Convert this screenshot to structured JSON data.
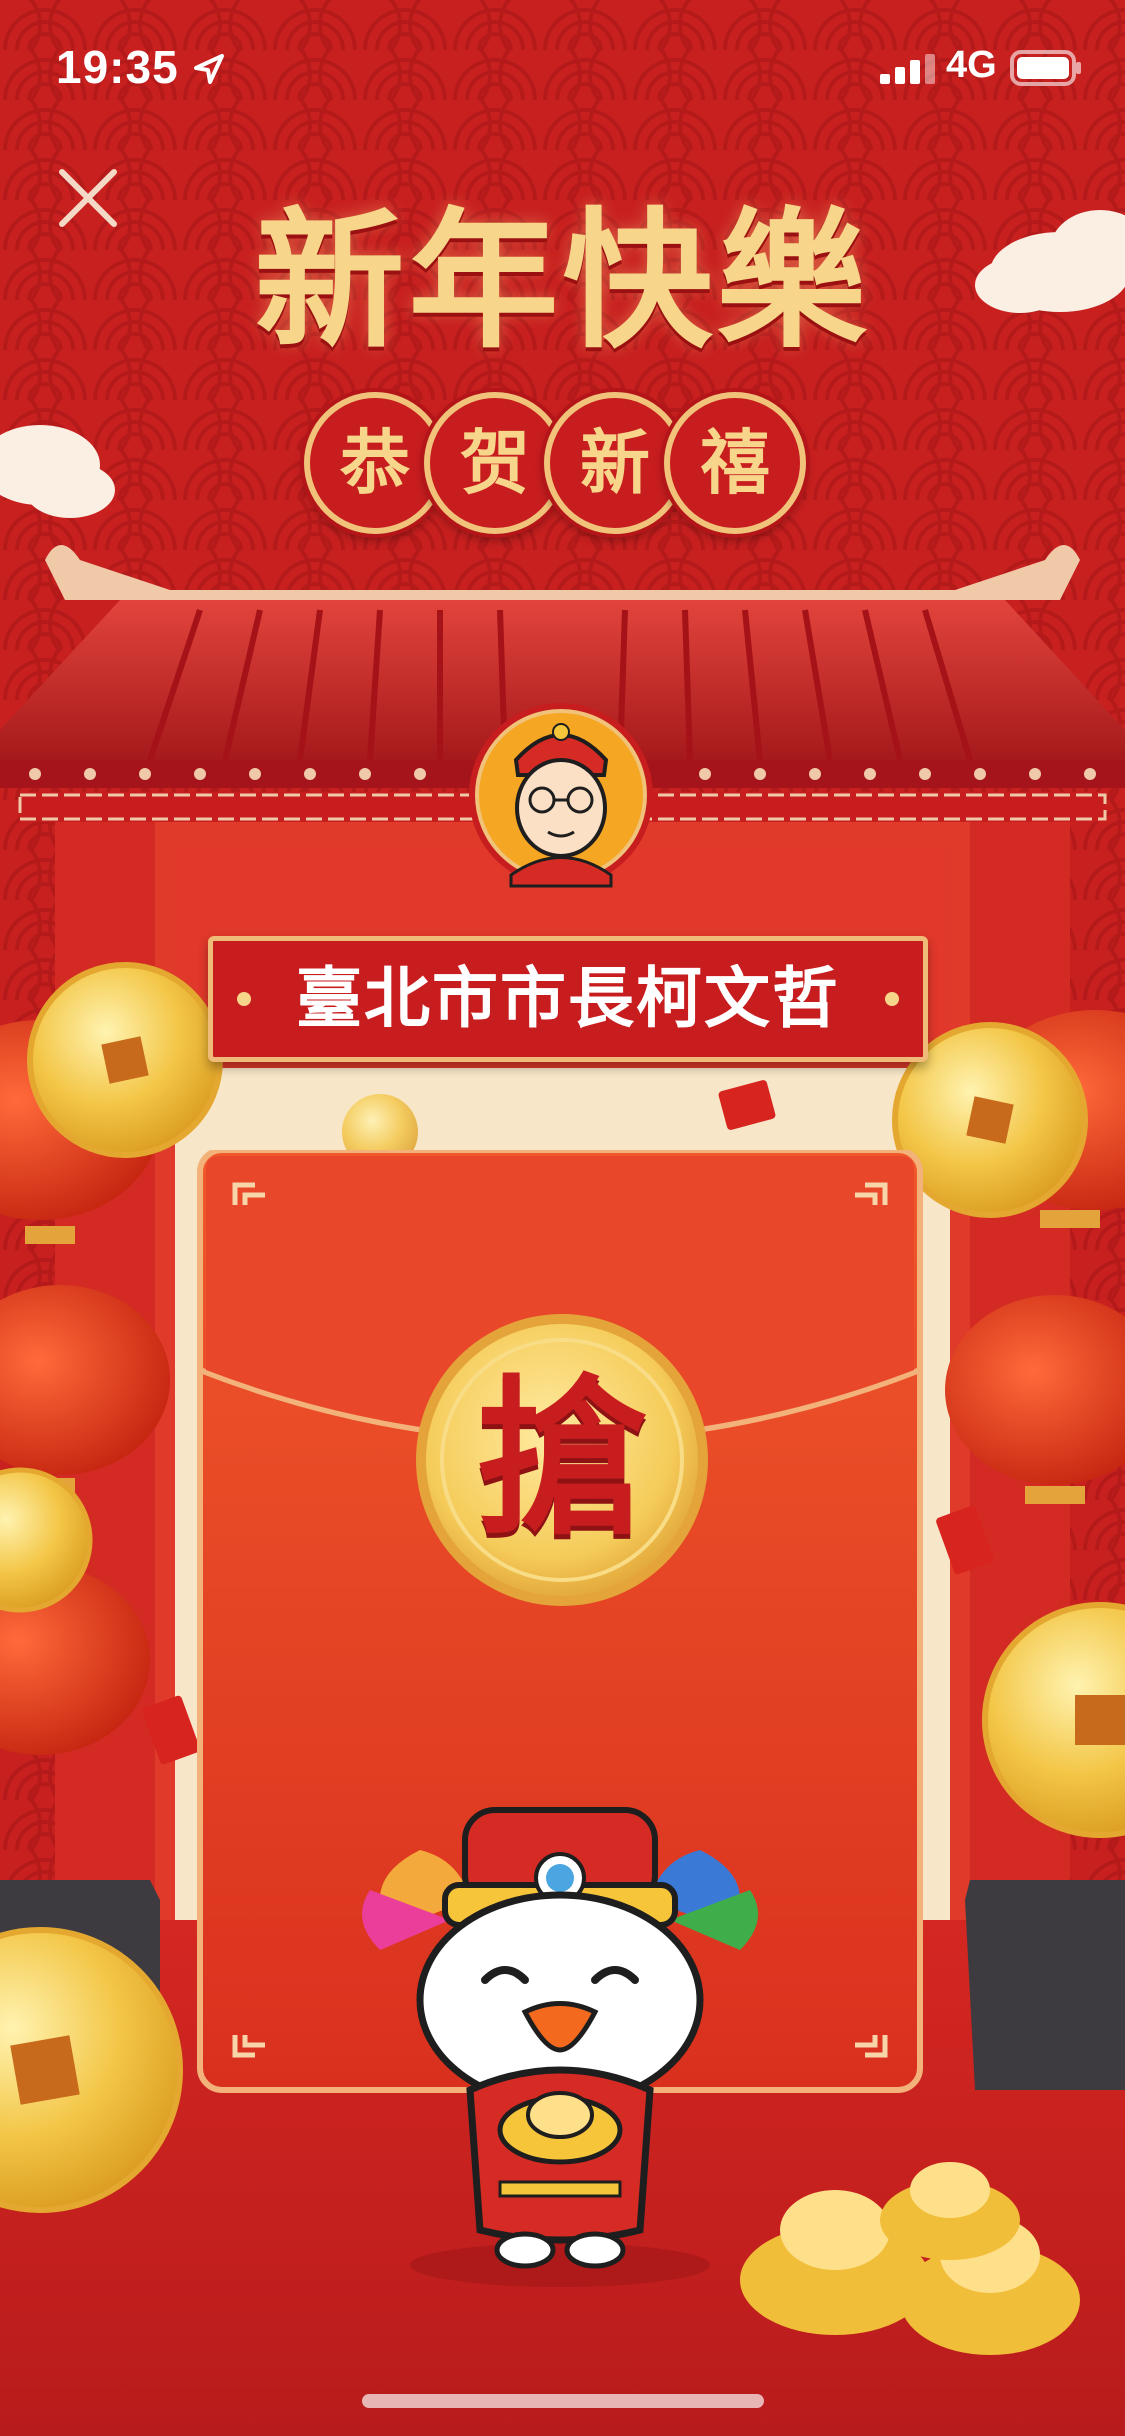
{
  "status_bar": {
    "time": "19:35",
    "network": "4G",
    "icons": [
      "location-arrow-icon",
      "signal-bars-icon",
      "battery-icon"
    ]
  },
  "header": {
    "title": "新年快樂",
    "seals": [
      "恭",
      "贺",
      "新",
      "禧"
    ]
  },
  "card": {
    "name": "臺北市市長柯文哲",
    "grab_label": "搶"
  },
  "icons": {
    "close": "close-icon",
    "avatar": "avatar-portrait-icon",
    "mascot": "fortune-god-mascot-icon"
  },
  "colors": {
    "background": "#c8201f",
    "gold": "#f7d58a",
    "envelope": "#e23a1f",
    "coin": "#f3c647"
  }
}
